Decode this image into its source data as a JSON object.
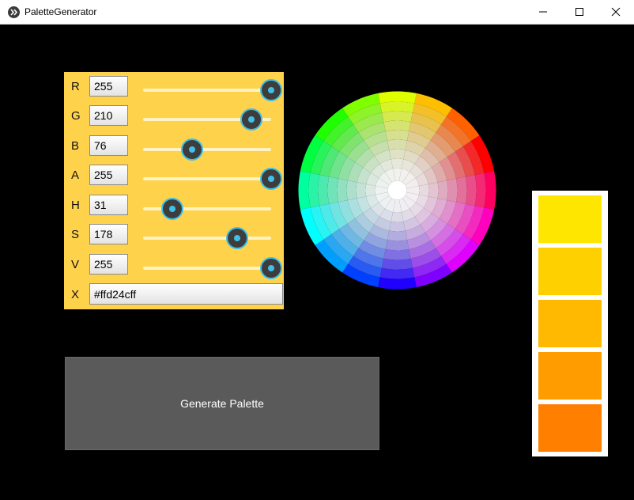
{
  "window": {
    "title": "PaletteGenerator",
    "minimize_glyph": "—",
    "maximize_glyph": "☐",
    "close_glyph": "✕"
  },
  "controls": {
    "rows": [
      {
        "label": "R",
        "value": "255",
        "level": 1.0
      },
      {
        "label": "G",
        "value": "210",
        "level": 0.8235
      },
      {
        "label": "B",
        "value": "76",
        "level": 0.298
      },
      {
        "label": "A",
        "value": "255",
        "level": 1.0
      },
      {
        "label": "H",
        "value": "31",
        "level": 0.122
      },
      {
        "label": "S",
        "value": "178",
        "level": 0.698
      },
      {
        "label": "V",
        "value": "255",
        "level": 1.0
      }
    ],
    "hex_label": "X",
    "hex_value": "#ffd24cff"
  },
  "generate_button": {
    "label": "Generate Palette"
  },
  "palette": {
    "swatches": [
      "#ffe600",
      "#ffd000",
      "#ffb900",
      "#ff9c00",
      "#ff7f00"
    ]
  },
  "colors": {
    "panel_bg": "#ffd24c",
    "accent": "#40c0e8",
    "button_bg": "#5a5a5a"
  }
}
